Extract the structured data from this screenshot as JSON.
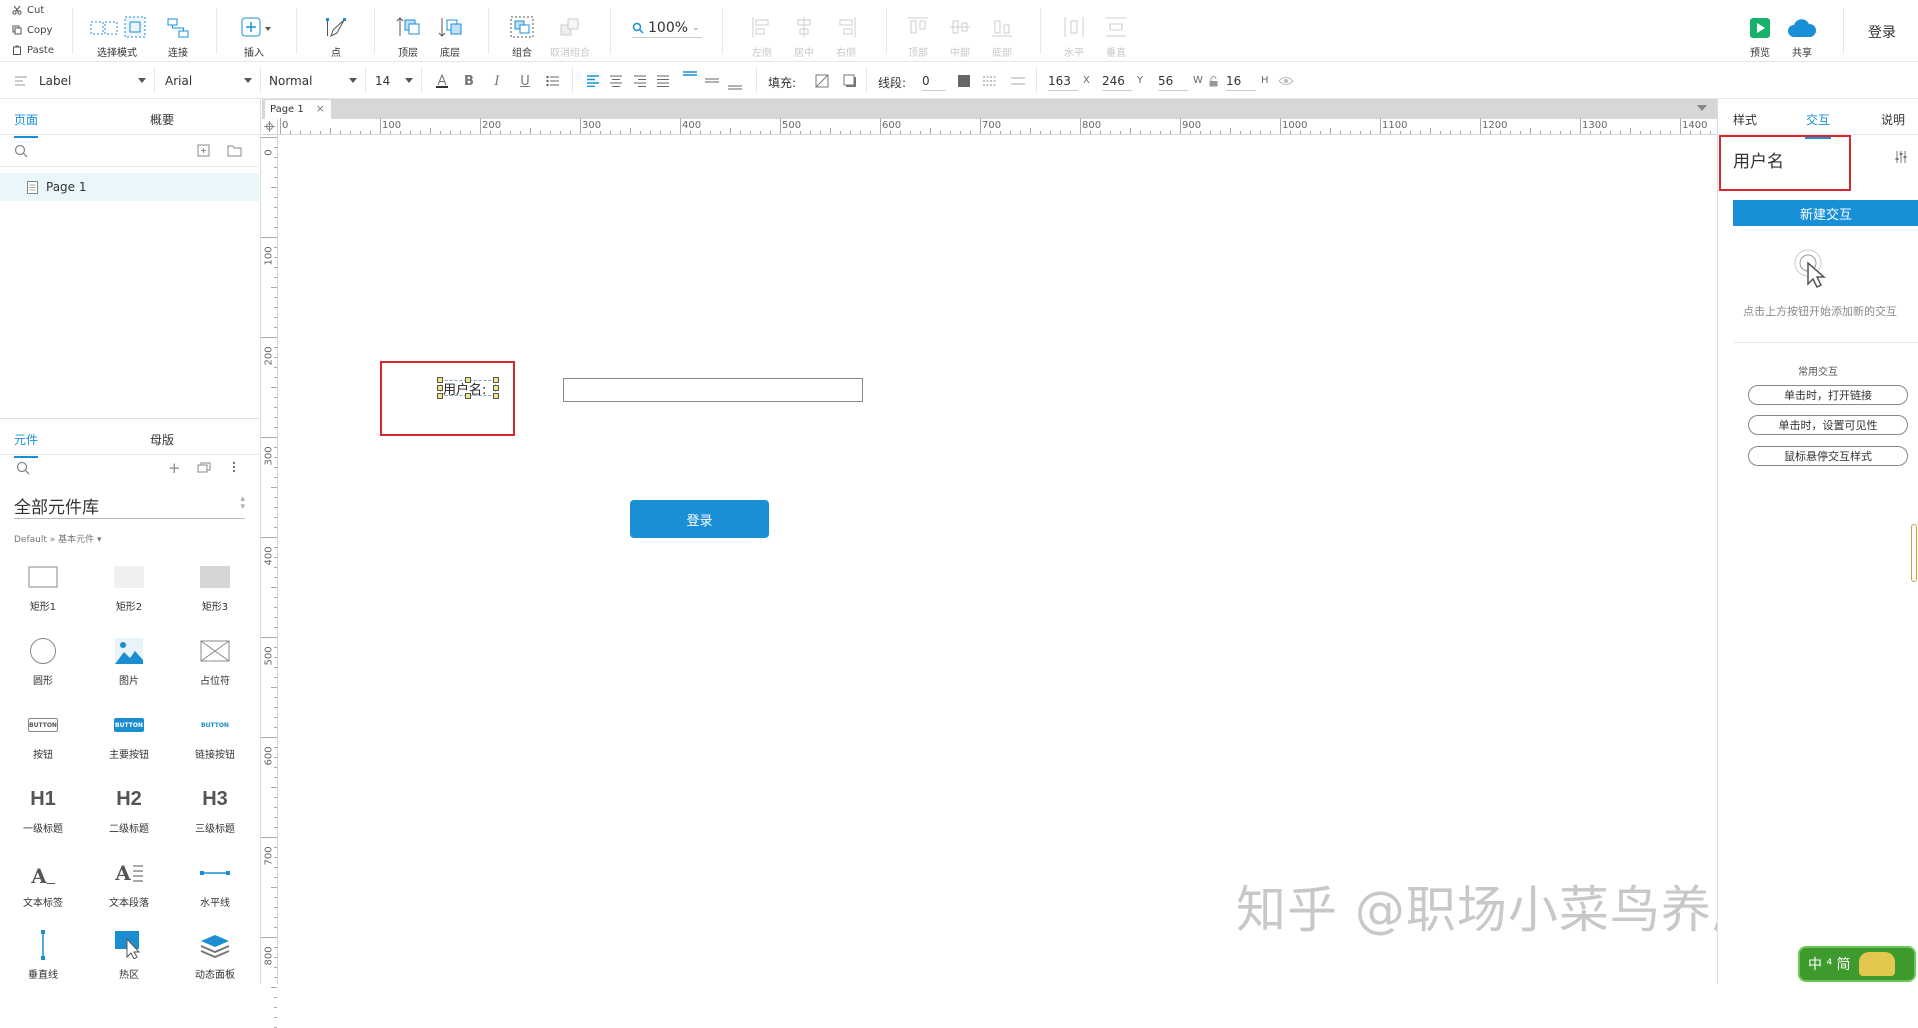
{
  "toolbar": {
    "clipboard": {
      "cut": "Cut",
      "copy": "Copy",
      "paste": "Paste"
    },
    "select_mode": "选择模式",
    "connect": "连接",
    "insert": "插入",
    "point": "点",
    "top_layer": "顶层",
    "bottom_layer": "底层",
    "group": "组合",
    "ungroup": "取消组合",
    "zoom": "100%",
    "align": {
      "left": "左侧",
      "center": "居中",
      "right": "右侧",
      "top": "顶部",
      "middle": "中部",
      "bottom": "底部"
    },
    "distribute": {
      "horizontal": "水平",
      "vertical": "垂直"
    },
    "preview": "预览",
    "share": "共享",
    "login": "登录"
  },
  "format": {
    "element_type": "Label",
    "font_family": "Arial",
    "font_style": "Normal",
    "font_size": "14",
    "fill_label": "填充:",
    "line_label": "线段:",
    "line_value": "0",
    "x_value": "163",
    "x_label": "X",
    "y_value": "246",
    "y_label": "Y",
    "w_value": "56",
    "w_label": "W",
    "h_value": "16",
    "h_label": "H"
  },
  "left": {
    "tabs": {
      "pages": "页面",
      "outline": "概要"
    },
    "page_item": "Page 1",
    "lib_tabs": {
      "widgets": "元件",
      "masters": "母版"
    },
    "library_title": "全部元件库",
    "library_path": "Default » 基本元件 ▾",
    "widgets": [
      {
        "label": "矩形1"
      },
      {
        "label": "矩形2"
      },
      {
        "label": "矩形3"
      },
      {
        "label": "圆形"
      },
      {
        "label": "图片"
      },
      {
        "label": "占位符"
      },
      {
        "label": "按钮",
        "icon_text": "BUTTON"
      },
      {
        "label": "主要按钮",
        "icon_text": "BUTTON"
      },
      {
        "label": "链接按钮",
        "icon_text": "BUTTON"
      },
      {
        "label": "一级标题",
        "icon_text": "H1"
      },
      {
        "label": "二级标题",
        "icon_text": "H2"
      },
      {
        "label": "三级标题",
        "icon_text": "H3"
      },
      {
        "label": "文本标签",
        "icon_text": "A"
      },
      {
        "label": "文本段落",
        "icon_text": "A"
      },
      {
        "label": "水平线"
      },
      {
        "label": "垂直线"
      },
      {
        "label": "热区"
      },
      {
        "label": "动态面板"
      }
    ]
  },
  "canvas": {
    "tab_name": "Page 1",
    "ruler_h": [
      "0",
      "100",
      "200",
      "300",
      "400",
      "500",
      "600",
      "700",
      "800",
      "900",
      "1000",
      "1100",
      "1200",
      "1300",
      "1400"
    ],
    "ruler_v": [
      "0",
      "100",
      "200",
      "300",
      "400",
      "500",
      "600",
      "700",
      "800"
    ],
    "label_text": "用户名:",
    "login_button": "登录",
    "watermark": "知乎 @职场小菜鸟养成记",
    "ime": "中 ⁴ 简"
  },
  "right": {
    "tabs": {
      "style": "样式",
      "interaction": "交互",
      "notes": "说明"
    },
    "element_name": "用户名",
    "new_interaction": "新建交互",
    "hint": "点击上方按钮开始添加新的交互",
    "common_title": "常用交互",
    "common_items": [
      "单击时，打开链接",
      "单击时，设置可见性",
      "鼠标悬停交互样式"
    ]
  },
  "colors": {
    "accent": "#1890d8",
    "highlight_box": "#d9272e",
    "selected_page": "#e9f7fb"
  }
}
